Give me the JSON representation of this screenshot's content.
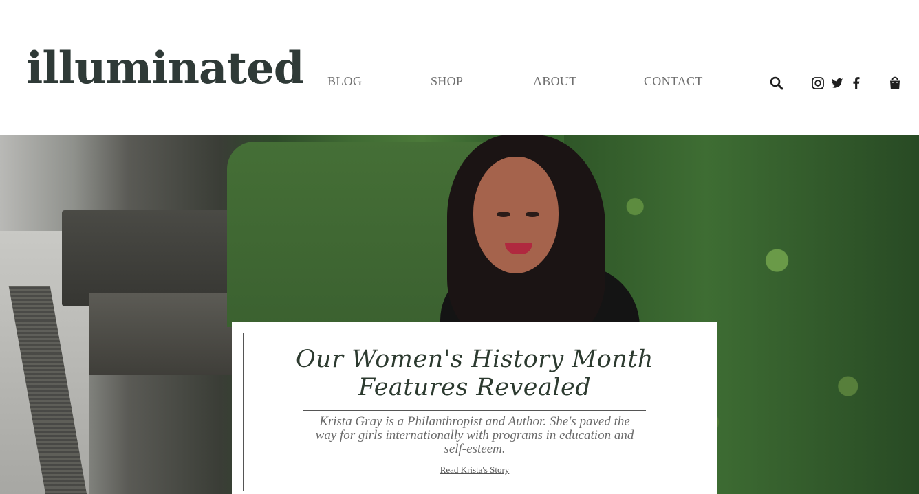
{
  "header": {
    "logo": "illuminated",
    "nav": {
      "blog": "BLOG",
      "shop": "SHOP",
      "about": "ABOUT",
      "contact": "CONTACT"
    },
    "icons": [
      "search-icon",
      "instagram-icon",
      "twitter-icon",
      "facebook-icon",
      "shopping-bag-icon"
    ]
  },
  "feature": {
    "title": "Our Women's History Month Features Revealed",
    "description": "Krista Gray is a Philanthropist and Author. She's paved the way for girls internationally with programs in education and self-esteem.",
    "link_label": "Read Krista's Story"
  },
  "colors": {
    "logo": "#2f3a37",
    "nav_text": "#6f6f6f",
    "title": "#2c3a2f",
    "description": "#6a6a6a"
  }
}
